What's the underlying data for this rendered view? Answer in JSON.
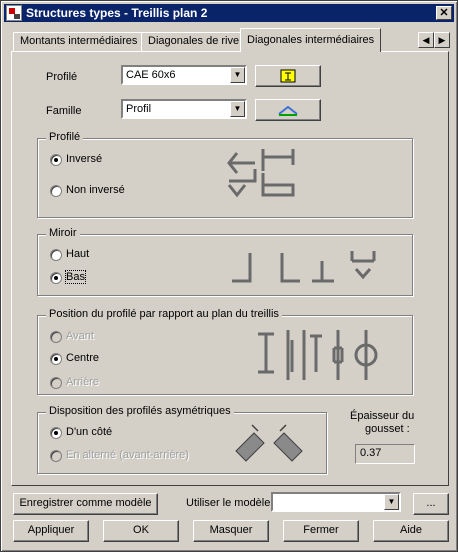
{
  "window": {
    "title": "Structures types - Treillis plan 2",
    "close": "✕"
  },
  "tabs": [
    {
      "label": "Montants intermédiaires"
    },
    {
      "label": "Diagonales de rive"
    },
    {
      "label": "Diagonales intermédiaires",
      "active": true
    }
  ],
  "tab_scroll": {
    "left": "◀",
    "right": "▶"
  },
  "form": {
    "profile_label": "Profilé",
    "profile_value": "CAE 60x6",
    "family_label": "Famille",
    "family_value": "Profil"
  },
  "groups": {
    "profile": {
      "title": "Profilé",
      "options": [
        "Inversé",
        "Non inversé"
      ],
      "selected": 0
    },
    "mirror": {
      "title": "Miroir",
      "options": [
        "Haut",
        "Bas"
      ],
      "selected": 1
    },
    "position": {
      "title": "Position du profilé par rapport au plan du treillis",
      "options": [
        "Avant",
        "Centre",
        "Arrière"
      ],
      "selected": 1,
      "disabled": [
        0,
        2
      ]
    },
    "asym": {
      "title": "Disposition des profilés asymétriques",
      "options": [
        "D'un côté",
        "En alterné (avant-arrière)"
      ],
      "selected": 0,
      "disabled": [
        1
      ]
    }
  },
  "gusset": {
    "label_line1": "Épaisseur du",
    "label_line2": "gousset :",
    "value": "0.37"
  },
  "model": {
    "save_label": "Enregistrer comme modèle",
    "use_label": "Utiliser le modèle",
    "value": "",
    "browse": "..."
  },
  "buttons": {
    "apply": "Appliquer",
    "ok": "OK",
    "hide": "Masquer",
    "close": "Fermer",
    "help": "Aide"
  },
  "colors": {
    "title_bar": "#0a246a",
    "dialog": "#d4d0c8",
    "icon_yellow": "#ffff00",
    "icon_green": "#00a000",
    "icon_blue": "#3a6fd8"
  }
}
